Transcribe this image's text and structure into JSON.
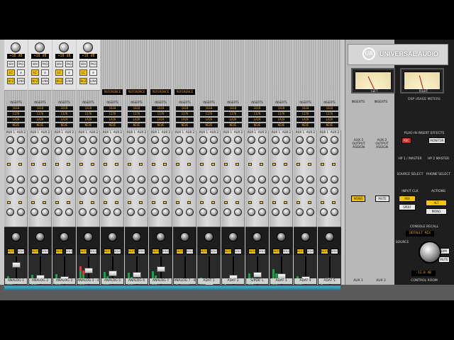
{
  "window": {
    "title": "Console"
  },
  "brand": {
    "name": "UNIVERSAL AUDIO",
    "mark": "UA"
  },
  "colors": {
    "accent": "#f4c400",
    "readout": "#f5a623",
    "meter": "#1aa44a",
    "brand_bg": "#d6d6d6"
  },
  "preamp": {
    "gain_readout": "+18 dB",
    "buttons": [
      "48V",
      "PAD",
      "LC",
      "ø",
      "HI-Z",
      "LINK"
    ]
  },
  "inserts_label": "INSERTS",
  "insert_values": [
    "1610",
    "1176",
    "LA2A",
    "NEVE"
  ],
  "reference_label": "REFERENCE",
  "aux_labels": [
    "AUX 1",
    "AUX 2"
  ],
  "pan_buttons": {
    "mute": "MUTE",
    "solo": "SOLO"
  },
  "channels": [
    {
      "name": "ANALOG 1",
      "has_preamp": true,
      "ref": false
    },
    {
      "name": "ANALOG 2",
      "has_preamp": true,
      "ref": false
    },
    {
      "name": "ANALOG 3",
      "has_preamp": true,
      "ref": false
    },
    {
      "name": "ANALOG 3 - 4",
      "has_preamp": true,
      "ref": false
    },
    {
      "name": "ANALOG 5",
      "has_preamp": false,
      "ref": true
    },
    {
      "name": "ANALOG 6",
      "has_preamp": false,
      "ref": true
    },
    {
      "name": "ANALOG 7",
      "has_preamp": false,
      "ref": true
    },
    {
      "name": "ANALOG 7 - 8",
      "has_preamp": false,
      "ref": true
    },
    {
      "name": "ADAT 1",
      "has_preamp": false,
      "ref": false
    },
    {
      "name": "ADAT 2",
      "has_preamp": false,
      "ref": false
    },
    {
      "name": "S/PDIF L",
      "has_preamp": false,
      "ref": false
    },
    {
      "name": "ADAT 3",
      "has_preamp": false,
      "ref": false
    },
    {
      "name": "ADAT 4",
      "has_preamp": false,
      "ref": false
    },
    {
      "name": "ADAT 5",
      "has_preamp": false,
      "ref": false
    }
  ],
  "aux_panel": {
    "labels": [
      "INSERTS",
      "INSERTS"
    ],
    "output_assign": [
      "AUX 1 OUTPUT ASSIGN",
      "AUX 2 OUTPUT ASSIGN"
    ],
    "bus_names": [
      "AUX 1",
      "AUX 2"
    ],
    "buttons": [
      "MONO",
      "MUTE"
    ]
  },
  "control": {
    "vu_left": "LEFT",
    "vu_right": "RIGHT",
    "dsp_meter": "DSP USAGE METERS",
    "plugin_effects": "PLUG-IN INSERT EFFECTS",
    "rec": "REC",
    "monitor": "MONITOR",
    "hp1": "HP 1 / MASTER",
    "hp2": "HP 2 MASTER",
    "source_select": "SOURCE SELECT",
    "phone_select": "PHONE SELECT",
    "mono": "MONO",
    "input_clk": "INPUT CLK",
    "actions": "ACTIONS",
    "console_recall": "CONSOLE RECALL",
    "console_recall_value": "DEFAULT MIX",
    "source": "SOURCE",
    "control_room": "CONTROL ROOM",
    "dim": "DIM",
    "mute": "MUTE",
    "level_readout": "-12.0 dB",
    "buttons": [
      "MIX",
      "ALT",
      "SPDIF",
      "MONO",
      "MUTE",
      "CLR"
    ]
  }
}
